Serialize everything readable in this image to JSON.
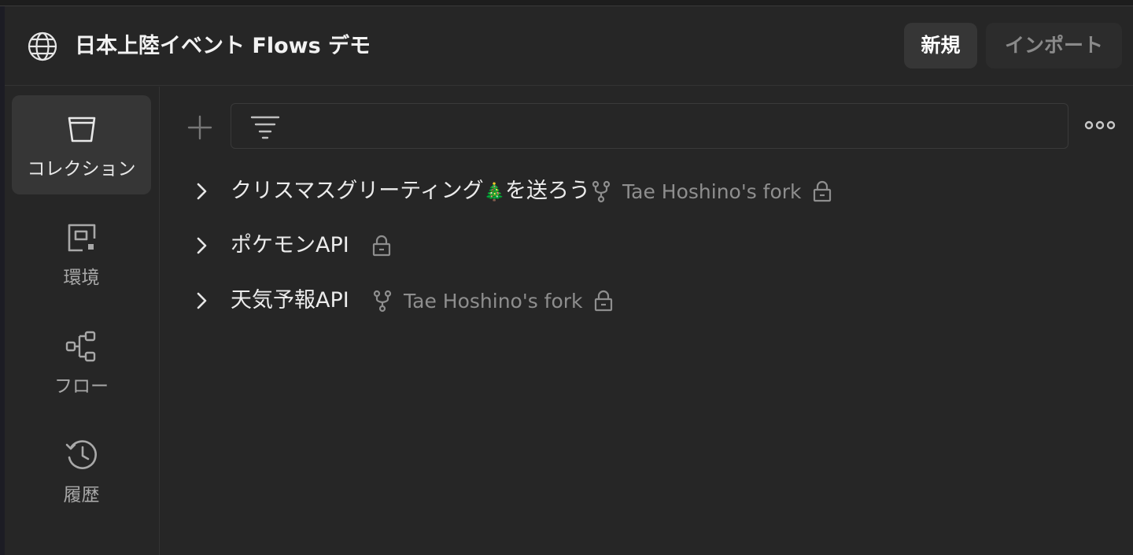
{
  "workspace": {
    "title": "日本上陸イベント Flows デモ",
    "icon": "globe-icon"
  },
  "header": {
    "new_label": "新規",
    "import_label": "インポート"
  },
  "sidebar": {
    "items": [
      {
        "label": "コレクション",
        "icon": "collections-icon",
        "active": true
      },
      {
        "label": "環境",
        "icon": "environment-icon",
        "active": false
      },
      {
        "label": "フロー",
        "icon": "flows-icon",
        "active": false
      },
      {
        "label": "履歴",
        "icon": "history-icon",
        "active": false
      }
    ]
  },
  "toolbar": {
    "search_value": "",
    "search_placeholder": ""
  },
  "collections": [
    {
      "name_before": "クリスマスグリーティング",
      "emoji": "🎄",
      "name_after": "を送ろう",
      "fork_label": "Tae Hoshino's fork",
      "locked": true
    },
    {
      "name_before": "ポケモンAPI",
      "emoji": "",
      "name_after": "",
      "fork_label": "",
      "locked": true
    },
    {
      "name_before": "天気予報API",
      "emoji": "",
      "name_after": "",
      "fork_label": "Tae Hoshino's fork",
      "locked": true
    }
  ],
  "colors": {
    "background": "#262626",
    "active_bg": "#363636",
    "muted_text": "#8e8e8e"
  }
}
